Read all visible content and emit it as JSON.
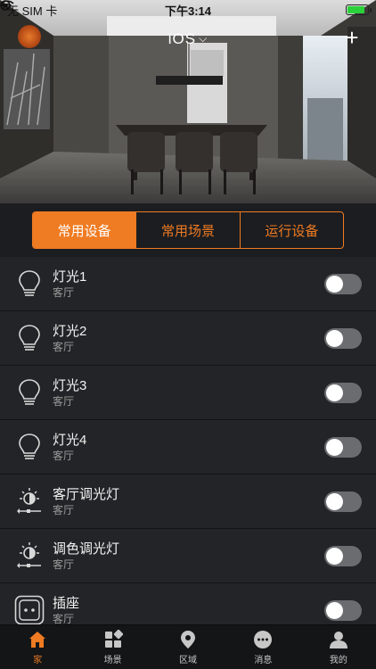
{
  "status_bar": {
    "carrier": "无 SIM 卡",
    "time": "下午3:14",
    "battery_level": 0.85
  },
  "header": {
    "title": "iOS",
    "logo_icon": "home-logo-icon",
    "add_icon": "plus-icon"
  },
  "tabs": [
    {
      "label": "常用设备",
      "active": true
    },
    {
      "label": "常用场景",
      "active": false
    },
    {
      "label": "运行设备",
      "active": false
    }
  ],
  "devices": [
    {
      "name": "灯光1",
      "room": "客厅",
      "icon": "lightbulb-icon",
      "on": false
    },
    {
      "name": "灯光2",
      "room": "客厅",
      "icon": "lightbulb-icon",
      "on": false
    },
    {
      "name": "灯光3",
      "room": "客厅",
      "icon": "lightbulb-icon",
      "on": false
    },
    {
      "name": "灯光4",
      "room": "客厅",
      "icon": "lightbulb-icon",
      "on": false
    },
    {
      "name": "客厅调光灯",
      "room": "客厅",
      "icon": "dimmer-icon",
      "on": false
    },
    {
      "name": "调色调光灯",
      "room": "客厅",
      "icon": "dimmer-icon",
      "on": false
    },
    {
      "name": "插座",
      "room": "客厅",
      "icon": "socket-icon",
      "on": false
    }
  ],
  "nav": [
    {
      "label": "家",
      "icon": "home-icon",
      "active": true
    },
    {
      "label": "场景",
      "icon": "scene-grid-icon",
      "active": false
    },
    {
      "label": "区域",
      "icon": "location-pin-icon",
      "active": false
    },
    {
      "label": "消息",
      "icon": "message-icon",
      "active": false
    },
    {
      "label": "我的",
      "icon": "user-icon",
      "active": false
    }
  ],
  "colors": {
    "accent": "#ef7b22",
    "background": "#1e1f22",
    "row": "#232427",
    "toggle_off": "#6a6c70"
  }
}
